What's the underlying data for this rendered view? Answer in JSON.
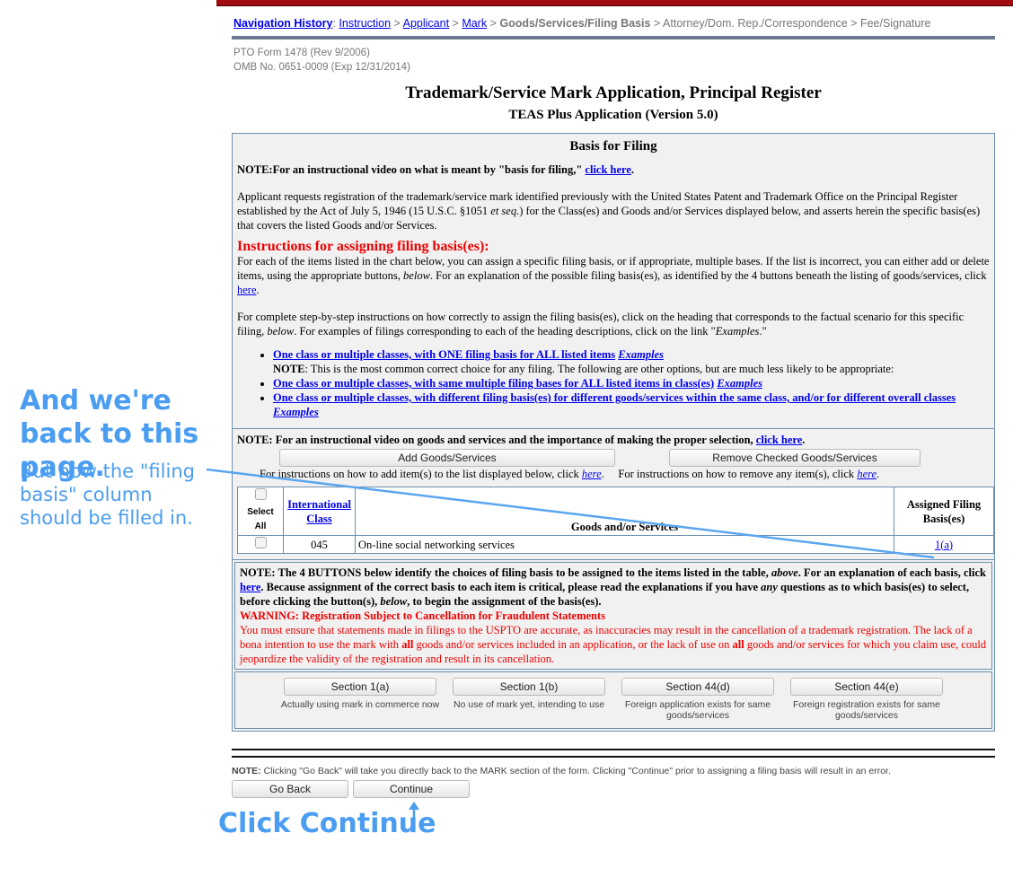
{
  "nav": {
    "label": "Navigation History",
    "items": [
      {
        "text": "Instruction",
        "link": true
      },
      {
        "text": "Applicant",
        "link": true
      },
      {
        "text": "Mark",
        "link": true
      },
      {
        "text": "Goods/Services/Filing Basis",
        "current": true
      },
      {
        "text": "Attorney/Dom. Rep./Correspondence"
      },
      {
        "text": "Fee/Signature"
      }
    ],
    "sep": ">"
  },
  "form_info": {
    "line1": "PTO Form 1478 (Rev 9/2006)",
    "line2": "OMB No. 0651-0009 (Exp 12/31/2014)"
  },
  "title": "Trademark/Service Mark Application, Principal Register",
  "subtitle": "TEAS Plus Application (Version 5.0)",
  "basis": {
    "heading": "Basis for Filing",
    "video_note": "NOTE:For an instructional video on what is meant by \"basis for filing,\"",
    "click_here": "click here",
    "intro1": "Applicant requests registration of the trademark/service mark identified previously with the United States Patent and Trademark Office on the Principal Register established by the Act of July 5, 1946 (15 U.S.C. §1051 ",
    "intro_et": "et seq.",
    "intro2": ") for the Class(es) and Goods and/or Services displayed below, and asserts herein the specific basis(es) that covers the listed Goods and/or Services.",
    "instr_heading": "Instructions for assigning filing basis(es):",
    "instr1a": "For each of the items listed in the chart below, you can assign a specific filing basis, or if appropriate, multiple bases. If the list is incorrect, you can either add or delete items, using the appropriate buttons, ",
    "below": "below",
    "instr1b": ". For an explanation of the possible filing basis(es), as identified by the 4 buttons beneath the listing of goods/services, click ",
    "here": "here",
    "instr2a": "For complete step-by-step instructions on how correctly to assign the filing basis(es), click on the heading that corresponds to the factual scenario for this specific filing, ",
    "instr2b": ". For examples of filings corresponding to each of the heading descriptions, click on the link \"",
    "examples_word": "Examples",
    "instr2c": ".\"",
    "options": [
      {
        "text": "One class or multiple classes, with ONE filing basis for ALL listed items",
        "examples": "Examples"
      },
      {
        "text": "One class or multiple classes, with same multiple filing bases for ALL listed items in class(es)",
        "examples": "Examples"
      },
      {
        "text": "One class or multiple classes, with different filing basis(es) for different goods/services within the same class, and/or for different overall classes",
        "examples": "Examples"
      }
    ],
    "note_label": "NOTE",
    "option_note": ": This is the most common correct choice for any filing. The following are other options, but are much less likely to be appropriate:"
  },
  "goods": {
    "video_note": "NOTE: For an instructional video on goods and services and the importance of making the proper selection,",
    "click_here": "click here",
    "add_button": "Add Goods/Services",
    "remove_button": "Remove Checked Goods/Services",
    "add_instr": "For instructions on how to add item(s) to the list displayed below, click ",
    "remove_instr": "For instructions on how to remove any item(s), click ",
    "here": "here",
    "headers": {
      "select_all": "Select All",
      "class": "International Class",
      "goods": "Goods and/or Services",
      "basis": "Assigned Filing Basis(es)"
    },
    "rows": [
      {
        "class": "045",
        "goods": "On-line social networking services",
        "basis": "1(a)",
        "checked": false
      }
    ]
  },
  "warning": {
    "note1": "NOTE: The 4 BUTTONS below identify the choices of filing basis to be assigned to the items listed in the table, ",
    "above": "above",
    "note2": ". For an explanation of each basis, click ",
    "here": "here",
    "note3": ". Because assignment of the correct basis to each item is critical, please read the explanations if you have ",
    "any": "any",
    "note4": " questions as to which basis(es) to select, before clicking the button(s), ",
    "below": "below",
    "note5": ", to begin the assignment of the basis(es).",
    "heading": "WARNING: Registration Subject to Cancellation for Fraudulent Statements",
    "text1": "You must ensure that statements made in filings to the USPTO are accurate, as inaccuracies may result in the cancellation of a trademark registration. The lack of a bona intention to use the mark with ",
    "all": "all",
    "text2": " goods and/or services included in an application, or the lack of use on ",
    "text3": " goods and/or services for which you claim use, could jeopardize the validity of the registration and result in its cancellation."
  },
  "sections": [
    {
      "label": "Section 1(a)",
      "desc": "Actually using mark in commerce now"
    },
    {
      "label": "Section 1(b)",
      "desc": "No use of mark yet, intending to use"
    },
    {
      "label": "Section 44(d)",
      "desc": "Foreign application exists for same goods/services"
    },
    {
      "label": "Section 44(e)",
      "desc": "Foreign registration exists for same goods/services"
    }
  ],
  "footer": {
    "note_label": "NOTE:",
    "note": " Clicking \"Go Back\" will take you directly back to the MARK section of the form. Clicking \"Continue\" prior to assigning a filing basis will result in an error.",
    "go_back": "Go Back",
    "continue": "Continue"
  },
  "annotations": {
    "headline": "And we're back to this page.",
    "subtext": "But now the \"filing basis\" column should be filled in.",
    "click_continue": "Click Continue"
  },
  "colors": {
    "annotation": "#4a9df0",
    "header_bar": "#a30d12",
    "warning": "#e00000"
  }
}
